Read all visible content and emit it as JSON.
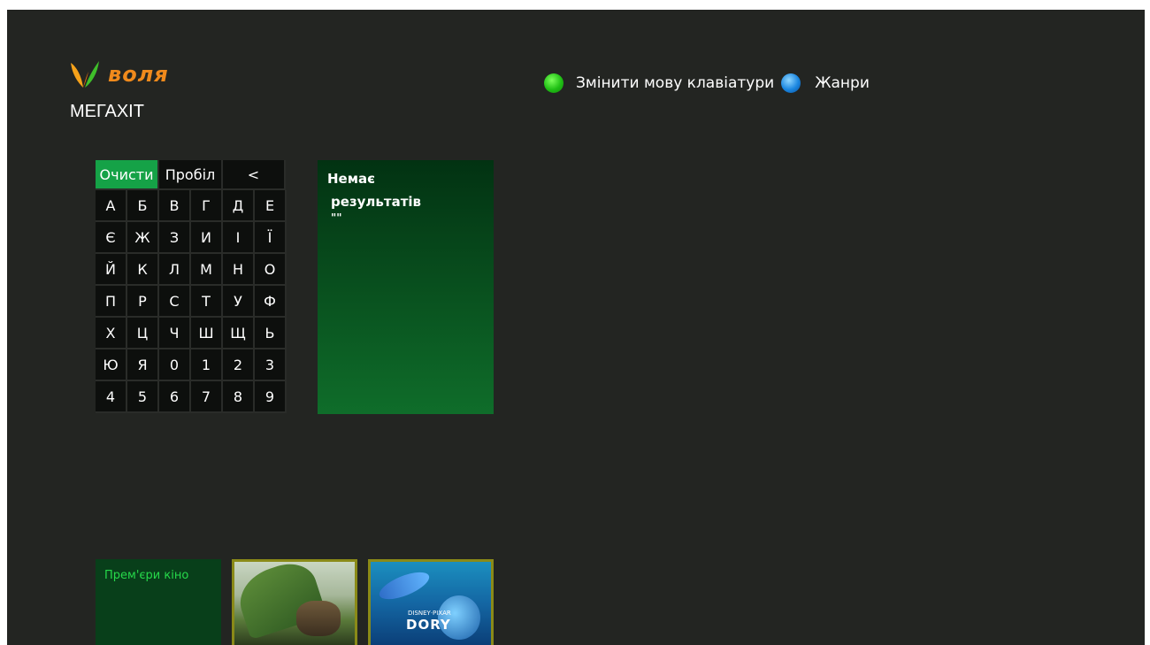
{
  "logo": {
    "brand": "воля"
  },
  "section_title": "МЕГАХІТ",
  "legend": {
    "green_label": "Змінити мову клавіатури",
    "blue_label": "Жанри"
  },
  "keyboard": {
    "clear_label": "Очисти",
    "space_label": "Пробіл",
    "backspace_label": "<",
    "keys": [
      "А",
      "Б",
      "В",
      "Г",
      "Д",
      "Е",
      "Є",
      "Ж",
      "З",
      "И",
      "І",
      "Ї",
      "Й",
      "К",
      "Л",
      "М",
      "Н",
      "О",
      "П",
      "Р",
      "С",
      "Т",
      "У",
      "Ф",
      "Х",
      "Ц",
      "Ч",
      "Ш",
      "Щ",
      "Ь",
      "Ю",
      "Я",
      "0",
      "1",
      "2",
      "3",
      "4",
      "5",
      "6",
      "7",
      "8",
      "9"
    ]
  },
  "results": {
    "line1": "Немає",
    "line2": "результатів",
    "line3": "\"\""
  },
  "bottom": {
    "category_label": "Прем'єри кіно",
    "poster2_brand": "DISNEY·PIXAR",
    "poster2_title": "DORY"
  },
  "colors": {
    "background": "#232522",
    "accent_green": "#15a247",
    "logo_orange": "#f08a1c"
  }
}
